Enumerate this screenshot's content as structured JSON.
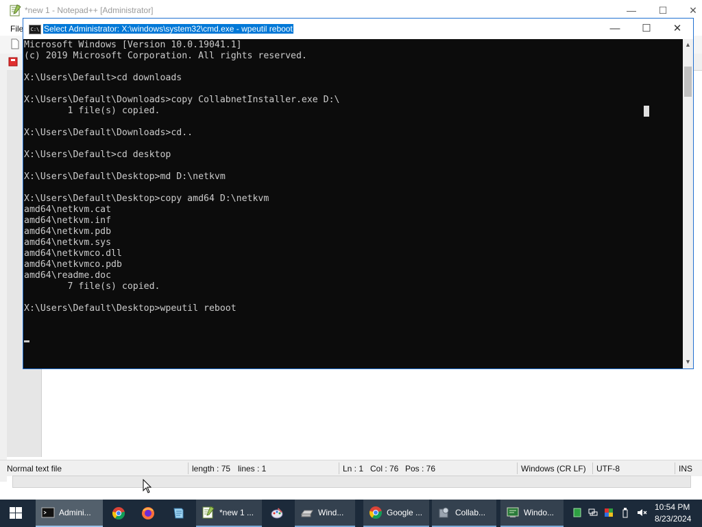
{
  "notepad": {
    "title": "*new 1 - Notepad++ [Administrator]",
    "menu_file": "File",
    "status": {
      "type": "Normal text file",
      "length": "length : 75",
      "lines": "lines : 1",
      "ln": "Ln : 1",
      "col": "Col : 76",
      "pos": "Pos : 76",
      "eol": "Windows (CR LF)",
      "encoding": "UTF-8",
      "mode": "INS"
    }
  },
  "cmd": {
    "title": "Select Administrator: X:\\windows\\system32\\cmd.exe - wpeutil  reboot",
    "icon_text": "C:\\",
    "output": "Microsoft Windows [Version 10.0.19041.1]\n(c) 2019 Microsoft Corporation. All rights reserved.\n\nX:\\Users\\Default>cd downloads\n\nX:\\Users\\Default\\Downloads>copy CollabnetInstaller.exe D:\\\n        1 file(s) copied.\n\nX:\\Users\\Default\\Downloads>cd..\n\nX:\\Users\\Default>cd desktop\n\nX:\\Users\\Default\\Desktop>md D:\\netkvm\n\nX:\\Users\\Default\\Desktop>copy amd64 D:\\netkvm\namd64\\netkvm.cat\namd64\\netkvm.inf\namd64\\netkvm.pdb\namd64\\netkvm.sys\namd64\\netkvmco.dll\namd64\\netkvmco.pdb\namd64\\readme.doc\n        7 file(s) copied.\n\nX:\\Users\\Default\\Desktop>wpeutil reboot"
  },
  "taskbar": {
    "windows": [
      {
        "label": "Admini...",
        "icon": "cmd-icon"
      },
      {
        "label": "*new 1 ...",
        "icon": "notepadpp-icon"
      },
      {
        "label": "Wind...",
        "icon": "drive-icon"
      },
      {
        "label": "Google ...",
        "icon": "chrome-icon"
      },
      {
        "label": "Collab...",
        "icon": "installer-icon"
      },
      {
        "label": "Windo...",
        "icon": "windows-setup-icon"
      }
    ],
    "pinned": [
      "chrome-icon",
      "firefox-icon",
      "notepad-icon",
      "paint-icon"
    ],
    "clock": {
      "time": "10:54 PM",
      "date": "8/23/2024"
    }
  },
  "colors": {
    "console_bg": "#0c0c0c",
    "console_text": "#cccccc",
    "title_selection": "#0078d7",
    "taskbar_bg": "#1c2a3a"
  }
}
